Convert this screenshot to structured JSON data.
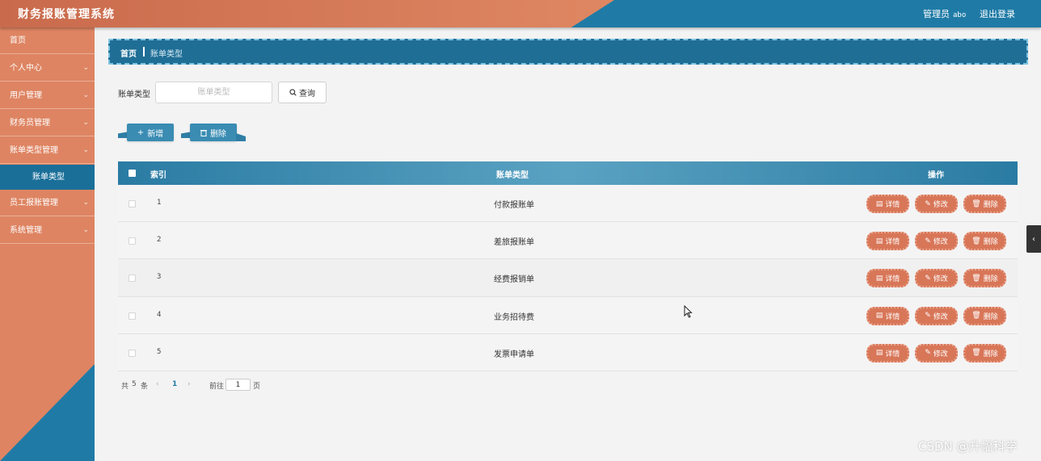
{
  "header": {
    "title": "财务报账管理系统",
    "user_role": "管理员",
    "user_name": "abo",
    "logout_label": "退出登录",
    "colors": {
      "orange": "#df8762",
      "blue": "#1f7ba6"
    }
  },
  "sidebar": {
    "items": [
      {
        "label": "首页",
        "chevron": ""
      },
      {
        "label": "个人中心",
        "chevron": "⌄"
      },
      {
        "label": "用户管理",
        "chevron": "⌄"
      },
      {
        "label": "财务员管理",
        "chevron": "⌄"
      },
      {
        "label": "账单类型管理",
        "chevron": "⌄"
      },
      {
        "label": "员工报账管理",
        "chevron": "⌄"
      },
      {
        "label": "系统管理",
        "chevron": "⌄"
      }
    ],
    "active_sub": "账单类型"
  },
  "breadcrumb": {
    "home": "首页",
    "current": "账单类型"
  },
  "search": {
    "label": "账单类型",
    "placeholder": "账单类型",
    "value": "",
    "button_label": "查询",
    "button_icon": "search-icon"
  },
  "toolbar": {
    "add_label": "新增",
    "add_icon": "plus-icon",
    "delete_label": "删除",
    "delete_icon": "trash-icon"
  },
  "table": {
    "headers": {
      "index": "索引",
      "type": "账单类型",
      "ops": "操作"
    },
    "rows": [
      {
        "index": "1",
        "type": "付款报账单"
      },
      {
        "index": "2",
        "type": "差旅报账单"
      },
      {
        "index": "3",
        "type": "经费报销单"
      },
      {
        "index": "4",
        "type": "业务招待费"
      },
      {
        "index": "5",
        "type": "发票申请单"
      }
    ],
    "actions": {
      "detail": "详情",
      "edit": "修改",
      "delete": "删除"
    },
    "action_color": "#d87658"
  },
  "pagination": {
    "total_prefix": "共",
    "total": "5",
    "total_suffix": "条",
    "prev": "‹",
    "current_page": "1",
    "next": "›",
    "goto_prefix": "前往",
    "goto_value": "1",
    "goto_suffix": "页"
  },
  "watermark": "CSDN @升幅科学"
}
